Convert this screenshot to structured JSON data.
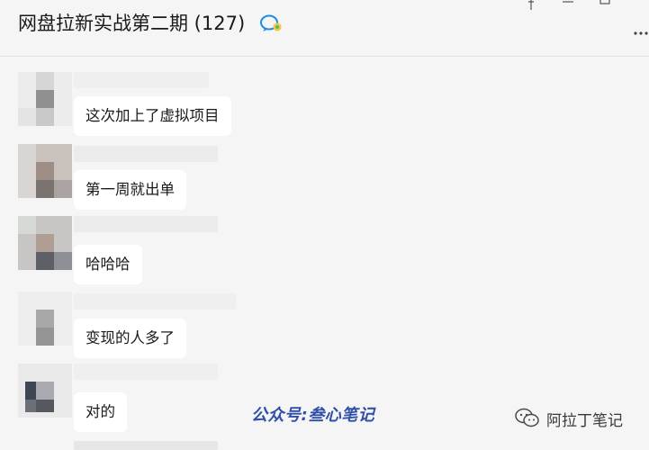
{
  "window": {
    "title": "网盘拉新实战第二期 (127)",
    "title_icon": "chat-bubble-icon",
    "controls": [
      "pin-icon",
      "minimize-icon",
      "maximize-icon",
      "more-icon"
    ]
  },
  "messages": [
    {
      "text": "这次加上了虚拟项目"
    },
    {
      "text": "第一周就出单"
    },
    {
      "text": "哈哈哈"
    },
    {
      "text": "变现的人多了"
    },
    {
      "text": "对的"
    }
  ],
  "watermarks": {
    "center": "公众号:叁心笔记",
    "right": "阿拉丁笔记",
    "right_icon": "wechat-icon"
  },
  "colors": {
    "background": "#f5f5f5",
    "bubble": "#ffffff",
    "watermark_center": "#2f4fa8"
  }
}
